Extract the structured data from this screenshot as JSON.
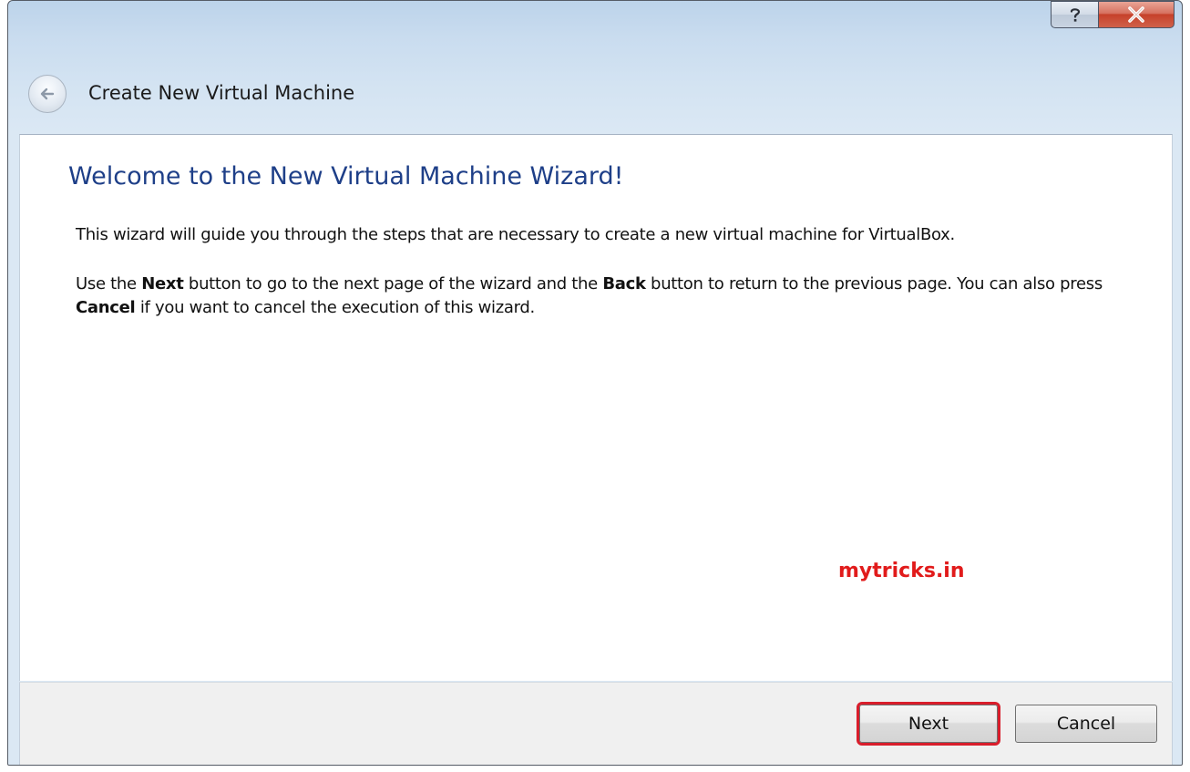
{
  "window": {
    "title": "Create New Virtual Machine",
    "controls": {
      "help_icon": "help-question-icon",
      "close_icon": "close-x-icon"
    }
  },
  "header": {
    "back_icon": "back-arrow-icon",
    "title": "Create New Virtual Machine"
  },
  "main": {
    "heading": "Welcome to the New Virtual Machine Wizard!",
    "paragraph1": "This wizard will guide you through the steps that are necessary to create a new virtual machine for VirtualBox.",
    "paragraph2": {
      "part1": "Use the ",
      "bold1": "Next",
      "part2": " button to go to the next page of the wizard and the ",
      "bold2": "Back",
      "part3": " button to return to the previous page. You can also press ",
      "bold3": "Cancel",
      "part4": " if you want to cancel the execution of this wizard."
    },
    "watermark": "mytricks.in"
  },
  "footer": {
    "next_label": "Next",
    "cancel_label": "Cancel"
  },
  "colors": {
    "heading": "#1e3f88",
    "watermark": "#e11b1b",
    "highlight_outline": "#d91d2b",
    "close_button": "#c6412a"
  }
}
